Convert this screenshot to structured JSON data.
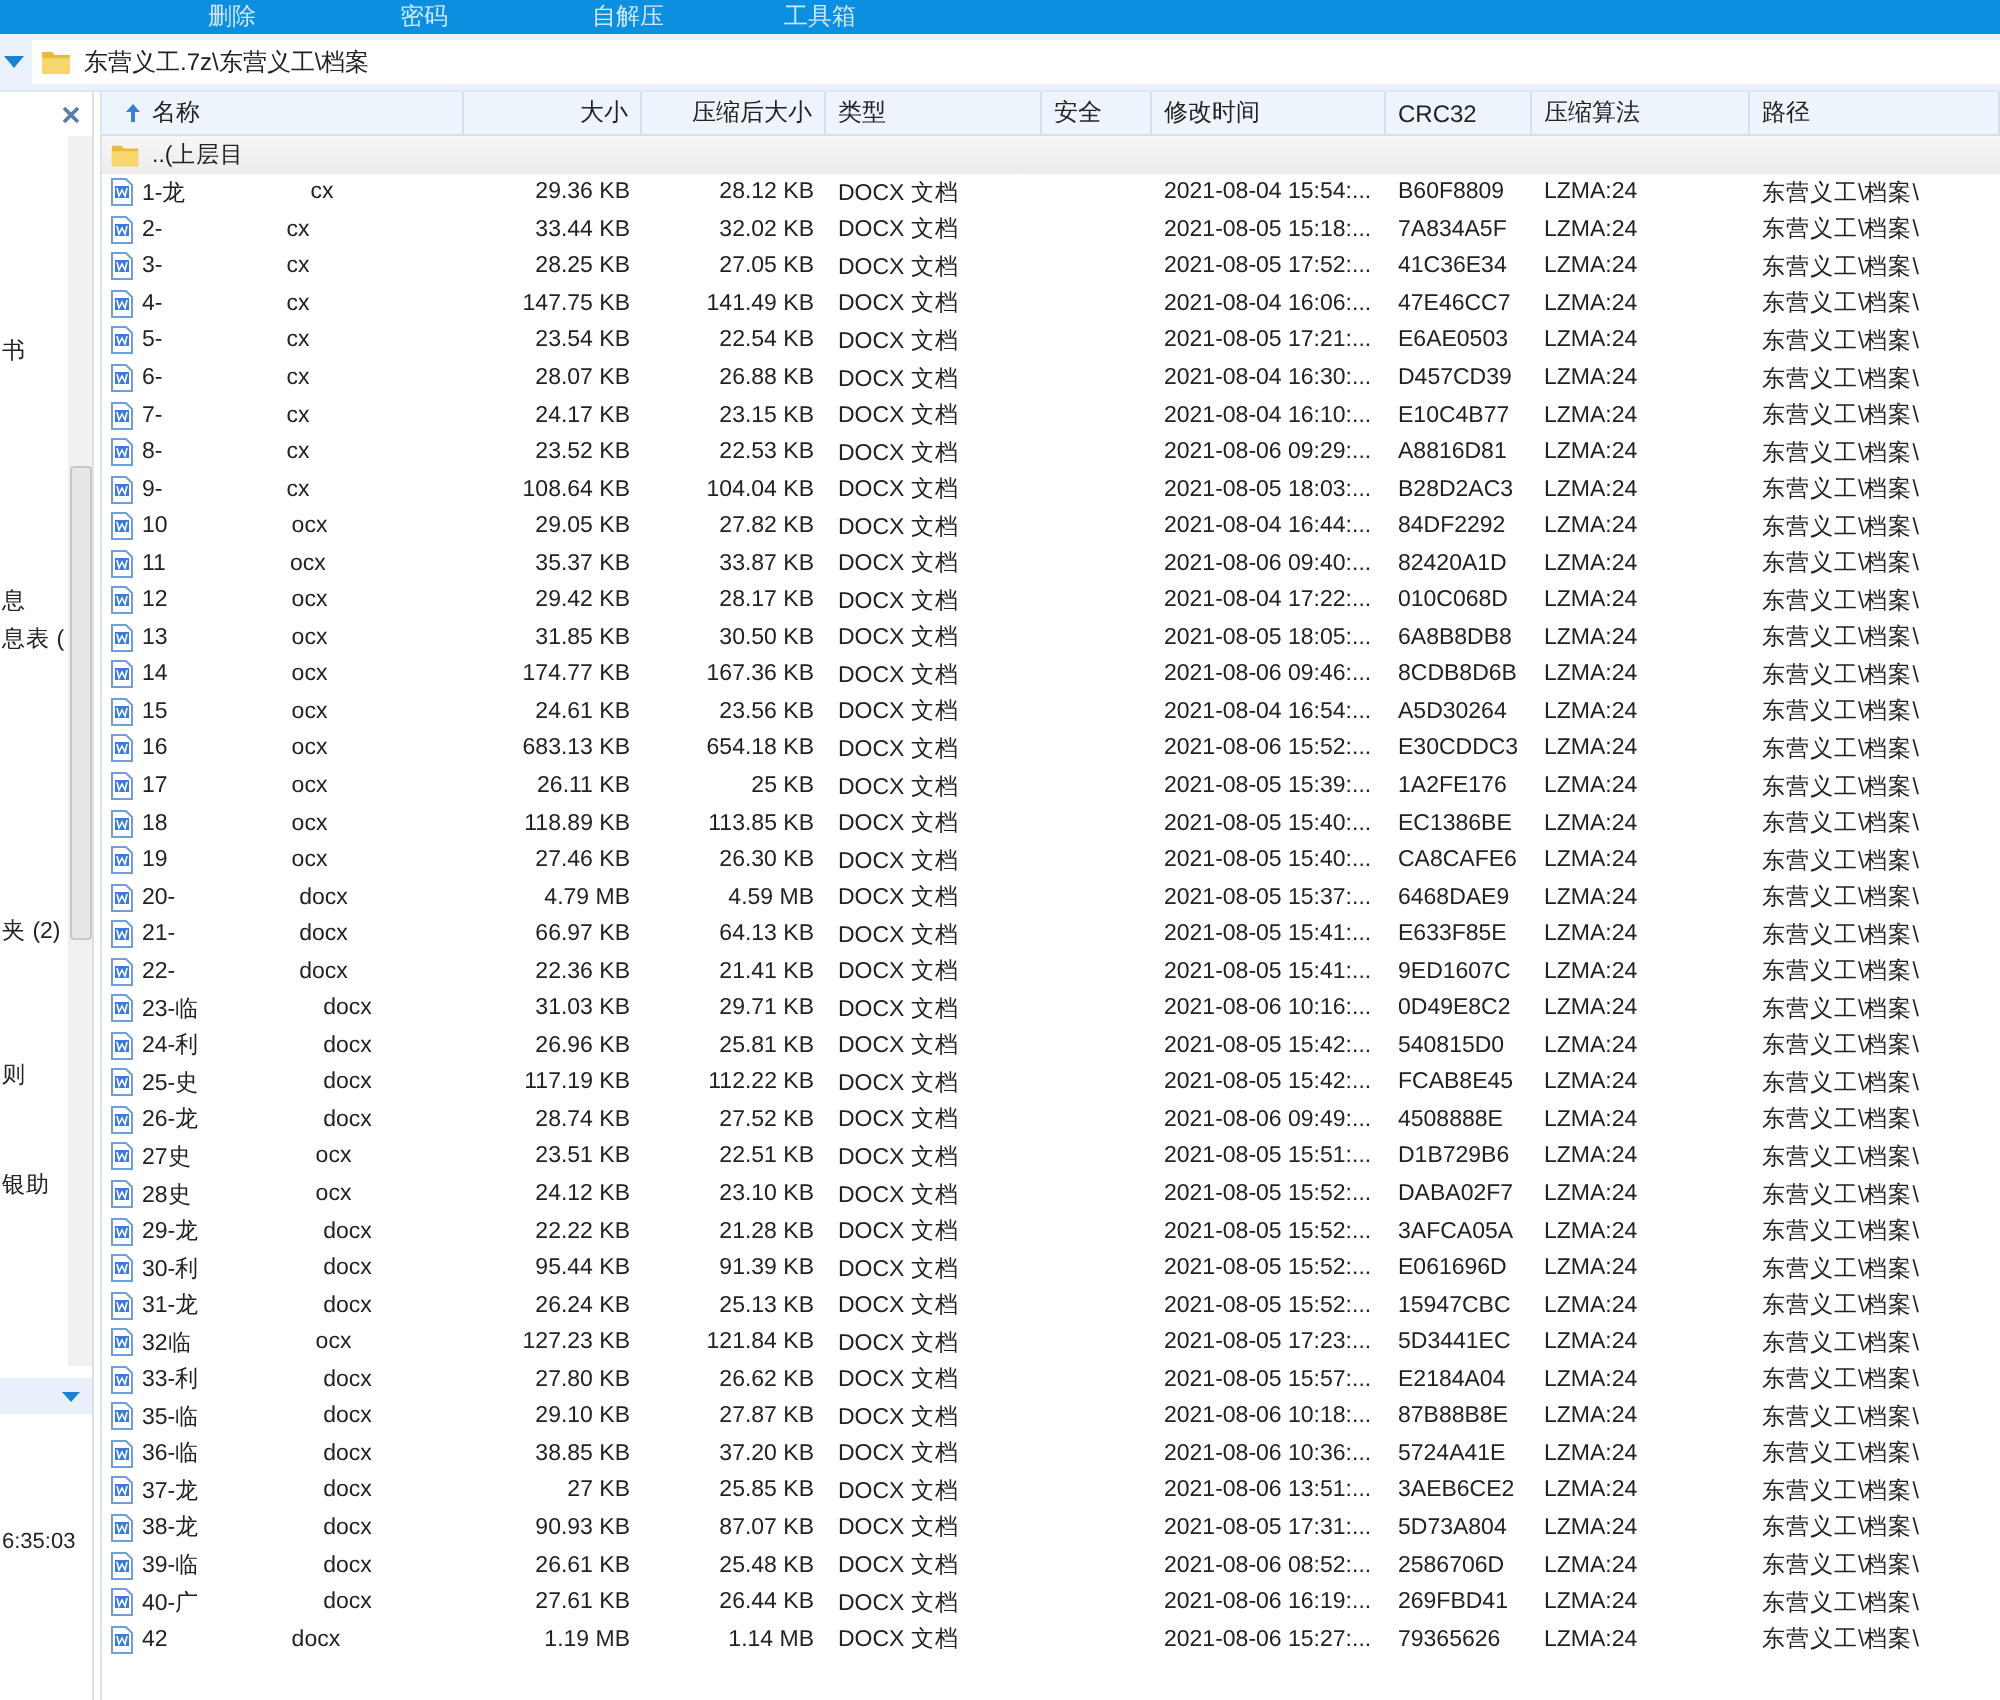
{
  "toolbar": [
    "删除",
    "密码",
    "自解压",
    "工具箱"
  ],
  "address": {
    "path": "东营义工.7z\\东营义工\\档案"
  },
  "left_panel": {
    "items": [
      {
        "text": "书"
      },
      {
        "text": "息"
      },
      {
        "text": "息表 ("
      },
      {
        "text": "夹 (2)"
      },
      {
        "text": "则"
      },
      {
        "text": "银助"
      }
    ],
    "footer": "6:35:03"
  },
  "table": {
    "columns": [
      {
        "label": "名称",
        "sorted": true
      },
      {
        "label": "大小",
        "sorted": false
      },
      {
        "label": "压缩后大小",
        "sorted": false
      },
      {
        "label": "类型",
        "sorted": false
      },
      {
        "label": "安全",
        "sorted": false
      },
      {
        "label": "修改时间",
        "sorted": false
      },
      {
        "label": "CRC32",
        "sorted": false
      },
      {
        "label": "压缩算法",
        "sorted": false
      },
      {
        "label": "路径",
        "sorted": false
      }
    ],
    "parent_row": {
      "name": "..(上层目"
    },
    "rows": [
      {
        "prefix": "1-龙",
        "suffix": "cx",
        "size": "29.36 KB",
        "packed": "28.12 KB",
        "type": "DOCX 文档",
        "modified": "2021-08-04 15:54:...",
        "crc": "B60F8809",
        "method": "LZMA:24",
        "path": "东营义工\\档案\\"
      },
      {
        "prefix": "2-",
        "suffix": "cx",
        "size": "33.44 KB",
        "packed": "32.02 KB",
        "type": "DOCX 文档",
        "modified": "2021-08-05 15:18:...",
        "crc": "7A834A5F",
        "method": "LZMA:24",
        "path": "东营义工\\档案\\"
      },
      {
        "prefix": "3-",
        "suffix": "cx",
        "size": "28.25 KB",
        "packed": "27.05 KB",
        "type": "DOCX 文档",
        "modified": "2021-08-05 17:52:...",
        "crc": "41C36E34",
        "method": "LZMA:24",
        "path": "东营义工\\档案\\"
      },
      {
        "prefix": "4-",
        "suffix": "cx",
        "size": "147.75 KB",
        "packed": "141.49 KB",
        "type": "DOCX 文档",
        "modified": "2021-08-04 16:06:...",
        "crc": "47E46CC7",
        "method": "LZMA:24",
        "path": "东营义工\\档案\\"
      },
      {
        "prefix": "5-",
        "suffix": "cx",
        "size": "23.54 KB",
        "packed": "22.54 KB",
        "type": "DOCX 文档",
        "modified": "2021-08-05 17:21:...",
        "crc": "E6AE0503",
        "method": "LZMA:24",
        "path": "东营义工\\档案\\"
      },
      {
        "prefix": "6-",
        "suffix": "cx",
        "size": "28.07 KB",
        "packed": "26.88 KB",
        "type": "DOCX 文档",
        "modified": "2021-08-04 16:30:...",
        "crc": "D457CD39",
        "method": "LZMA:24",
        "path": "东营义工\\档案\\"
      },
      {
        "prefix": "7-",
        "suffix": "cx",
        "size": "24.17 KB",
        "packed": "23.15 KB",
        "type": "DOCX 文档",
        "modified": "2021-08-04 16:10:...",
        "crc": "E10C4B77",
        "method": "LZMA:24",
        "path": "东营义工\\档案\\"
      },
      {
        "prefix": "8-",
        "suffix": "cx",
        "size": "23.52 KB",
        "packed": "22.53 KB",
        "type": "DOCX 文档",
        "modified": "2021-08-06 09:29:...",
        "crc": "A8816D81",
        "method": "LZMA:24",
        "path": "东营义工\\档案\\"
      },
      {
        "prefix": "9-",
        "suffix": "cx",
        "size": "108.64 KB",
        "packed": "104.04 KB",
        "type": "DOCX 文档",
        "modified": "2021-08-05 18:03:...",
        "crc": "B28D2AC3",
        "method": "LZMA:24",
        "path": "东营义工\\档案\\"
      },
      {
        "prefix": "10",
        "suffix": "ocx",
        "size": "29.05 KB",
        "packed": "27.82 KB",
        "type": "DOCX 文档",
        "modified": "2021-08-04 16:44:...",
        "crc": "84DF2292",
        "method": "LZMA:24",
        "path": "东营义工\\档案\\"
      },
      {
        "prefix": "11",
        "suffix": "ocx",
        "size": "35.37 KB",
        "packed": "33.87 KB",
        "type": "DOCX 文档",
        "modified": "2021-08-06 09:40:...",
        "crc": "82420A1D",
        "method": "LZMA:24",
        "path": "东营义工\\档案\\"
      },
      {
        "prefix": "12",
        "suffix": "ocx",
        "size": "29.42 KB",
        "packed": "28.17 KB",
        "type": "DOCX 文档",
        "modified": "2021-08-04 17:22:...",
        "crc": "010C068D",
        "method": "LZMA:24",
        "path": "东营义工\\档案\\"
      },
      {
        "prefix": "13",
        "suffix": "ocx",
        "size": "31.85 KB",
        "packed": "30.50 KB",
        "type": "DOCX 文档",
        "modified": "2021-08-05 18:05:...",
        "crc": "6A8B8DB8",
        "method": "LZMA:24",
        "path": "东营义工\\档案\\"
      },
      {
        "prefix": "14",
        "suffix": "ocx",
        "size": "174.77 KB",
        "packed": "167.36 KB",
        "type": "DOCX 文档",
        "modified": "2021-08-06 09:46:...",
        "crc": "8CDB8D6B",
        "method": "LZMA:24",
        "path": "东营义工\\档案\\"
      },
      {
        "prefix": "15",
        "suffix": "ocx",
        "size": "24.61 KB",
        "packed": "23.56 KB",
        "type": "DOCX 文档",
        "modified": "2021-08-04 16:54:...",
        "crc": "A5D30264",
        "method": "LZMA:24",
        "path": "东营义工\\档案\\"
      },
      {
        "prefix": "16",
        "suffix": "ocx",
        "size": "683.13 KB",
        "packed": "654.18 KB",
        "type": "DOCX 文档",
        "modified": "2021-08-06 15:52:...",
        "crc": "E30CDDC3",
        "method": "LZMA:24",
        "path": "东营义工\\档案\\"
      },
      {
        "prefix": "17",
        "suffix": "ocx",
        "size": "26.11 KB",
        "packed": "25 KB",
        "type": "DOCX 文档",
        "modified": "2021-08-05 15:39:...",
        "crc": "1A2FE176",
        "method": "LZMA:24",
        "path": "东营义工\\档案\\"
      },
      {
        "prefix": "18",
        "suffix": "ocx",
        "size": "118.89 KB",
        "packed": "113.85 KB",
        "type": "DOCX 文档",
        "modified": "2021-08-05 15:40:...",
        "crc": "EC1386BE",
        "method": "LZMA:24",
        "path": "东营义工\\档案\\"
      },
      {
        "prefix": "19",
        "suffix": "ocx",
        "size": "27.46 KB",
        "packed": "26.30 KB",
        "type": "DOCX 文档",
        "modified": "2021-08-05 15:40:...",
        "crc": "CA8CAFE6",
        "method": "LZMA:24",
        "path": "东营义工\\档案\\"
      },
      {
        "prefix": "20-",
        "suffix": "docx",
        "size": "4.79 MB",
        "packed": "4.59 MB",
        "type": "DOCX 文档",
        "modified": "2021-08-05 15:37:...",
        "crc": "6468DAE9",
        "method": "LZMA:24",
        "path": "东营义工\\档案\\"
      },
      {
        "prefix": "21-",
        "suffix": "docx",
        "size": "66.97 KB",
        "packed": "64.13 KB",
        "type": "DOCX 文档",
        "modified": "2021-08-05 15:41:...",
        "crc": "E633F85E",
        "method": "LZMA:24",
        "path": "东营义工\\档案\\"
      },
      {
        "prefix": "22-",
        "suffix": "docx",
        "size": "22.36 KB",
        "packed": "21.41 KB",
        "type": "DOCX 文档",
        "modified": "2021-08-05 15:41:...",
        "crc": "9ED1607C",
        "method": "LZMA:24",
        "path": "东营义工\\档案\\"
      },
      {
        "prefix": "23-临",
        "suffix": "docx",
        "size": "31.03 KB",
        "packed": "29.71 KB",
        "type": "DOCX 文档",
        "modified": "2021-08-06 10:16:...",
        "crc": "0D49E8C2",
        "method": "LZMA:24",
        "path": "东营义工\\档案\\"
      },
      {
        "prefix": "24-利",
        "suffix": "docx",
        "size": "26.96 KB",
        "packed": "25.81 KB",
        "type": "DOCX 文档",
        "modified": "2021-08-05 15:42:...",
        "crc": "540815D0",
        "method": "LZMA:24",
        "path": "东营义工\\档案\\"
      },
      {
        "prefix": "25-史",
        "suffix": "docx",
        "size": "117.19 KB",
        "packed": "112.22 KB",
        "type": "DOCX 文档",
        "modified": "2021-08-05 15:42:...",
        "crc": "FCAB8E45",
        "method": "LZMA:24",
        "path": "东营义工\\档案\\"
      },
      {
        "prefix": "26-龙",
        "suffix": "docx",
        "size": "28.74 KB",
        "packed": "27.52 KB",
        "type": "DOCX 文档",
        "modified": "2021-08-06 09:49:...",
        "crc": "4508888E",
        "method": "LZMA:24",
        "path": "东营义工\\档案\\"
      },
      {
        "prefix": "27史",
        "suffix": "ocx",
        "size": "23.51 KB",
        "packed": "22.51 KB",
        "type": "DOCX 文档",
        "modified": "2021-08-05 15:51:...",
        "crc": "D1B729B6",
        "method": "LZMA:24",
        "path": "东营义工\\档案\\"
      },
      {
        "prefix": "28史",
        "suffix": "ocx",
        "size": "24.12 KB",
        "packed": "23.10 KB",
        "type": "DOCX 文档",
        "modified": "2021-08-05 15:52:...",
        "crc": "DABA02F7",
        "method": "LZMA:24",
        "path": "东营义工\\档案\\"
      },
      {
        "prefix": "29-龙",
        "suffix": "docx",
        "size": "22.22 KB",
        "packed": "21.28 KB",
        "type": "DOCX 文档",
        "modified": "2021-08-05 15:52:...",
        "crc": "3AFCA05A",
        "method": "LZMA:24",
        "path": "东营义工\\档案\\"
      },
      {
        "prefix": "30-利",
        "suffix": "docx",
        "size": "95.44 KB",
        "packed": "91.39 KB",
        "type": "DOCX 文档",
        "modified": "2021-08-05 15:52:...",
        "crc": "E061696D",
        "method": "LZMA:24",
        "path": "东营义工\\档案\\"
      },
      {
        "prefix": "31-龙",
        "suffix": "docx",
        "size": "26.24 KB",
        "packed": "25.13 KB",
        "type": "DOCX 文档",
        "modified": "2021-08-05 15:52:...",
        "crc": "15947CBC",
        "method": "LZMA:24",
        "path": "东营义工\\档案\\"
      },
      {
        "prefix": "32临",
        "suffix": "ocx",
        "size": "127.23 KB",
        "packed": "121.84 KB",
        "type": "DOCX 文档",
        "modified": "2021-08-05 17:23:...",
        "crc": "5D3441EC",
        "method": "LZMA:24",
        "path": "东营义工\\档案\\"
      },
      {
        "prefix": "33-利",
        "suffix": "docx",
        "size": "27.80 KB",
        "packed": "26.62 KB",
        "type": "DOCX 文档",
        "modified": "2021-08-05 15:57:...",
        "crc": "E2184A04",
        "method": "LZMA:24",
        "path": "东营义工\\档案\\"
      },
      {
        "prefix": "35-临",
        "suffix": "docx",
        "size": "29.10 KB",
        "packed": "27.87 KB",
        "type": "DOCX 文档",
        "modified": "2021-08-06 10:18:...",
        "crc": "87B88B8E",
        "method": "LZMA:24",
        "path": "东营义工\\档案\\"
      },
      {
        "prefix": "36-临",
        "suffix": "docx",
        "size": "38.85 KB",
        "packed": "37.20 KB",
        "type": "DOCX 文档",
        "modified": "2021-08-06 10:36:...",
        "crc": "5724A41E",
        "method": "LZMA:24",
        "path": "东营义工\\档案\\"
      },
      {
        "prefix": "37-龙",
        "suffix": "docx",
        "size": "27 KB",
        "packed": "25.85 KB",
        "type": "DOCX 文档",
        "modified": "2021-08-06 13:51:...",
        "crc": "3AEB6CE2",
        "method": "LZMA:24",
        "path": "东营义工\\档案\\"
      },
      {
        "prefix": "38-龙",
        "suffix": "docx",
        "size": "90.93 KB",
        "packed": "87.07 KB",
        "type": "DOCX 文档",
        "modified": "2021-08-05 17:31:...",
        "crc": "5D73A804",
        "method": "LZMA:24",
        "path": "东营义工\\档案\\"
      },
      {
        "prefix": "39-临",
        "suffix": "docx",
        "size": "26.61 KB",
        "packed": "25.48 KB",
        "type": "DOCX 文档",
        "modified": "2021-08-06 08:52:...",
        "crc": "2586706D",
        "method": "LZMA:24",
        "path": "东营义工\\档案\\"
      },
      {
        "prefix": "40-广",
        "suffix": "docx",
        "size": "27.61 KB",
        "packed": "26.44 KB",
        "type": "DOCX 文档",
        "modified": "2021-08-06 16:19:...",
        "crc": "269FBD41",
        "method": "LZMA:24",
        "path": "东营义工\\档案\\"
      },
      {
        "prefix": "42",
        "suffix": "docx",
        "size": "1.19 MB",
        "packed": "1.14 MB",
        "type": "DOCX 文档",
        "modified": "2021-08-06 15:27:...",
        "crc": "79365626",
        "method": "LZMA:24",
        "path": "东营义工\\档案\\"
      }
    ]
  }
}
